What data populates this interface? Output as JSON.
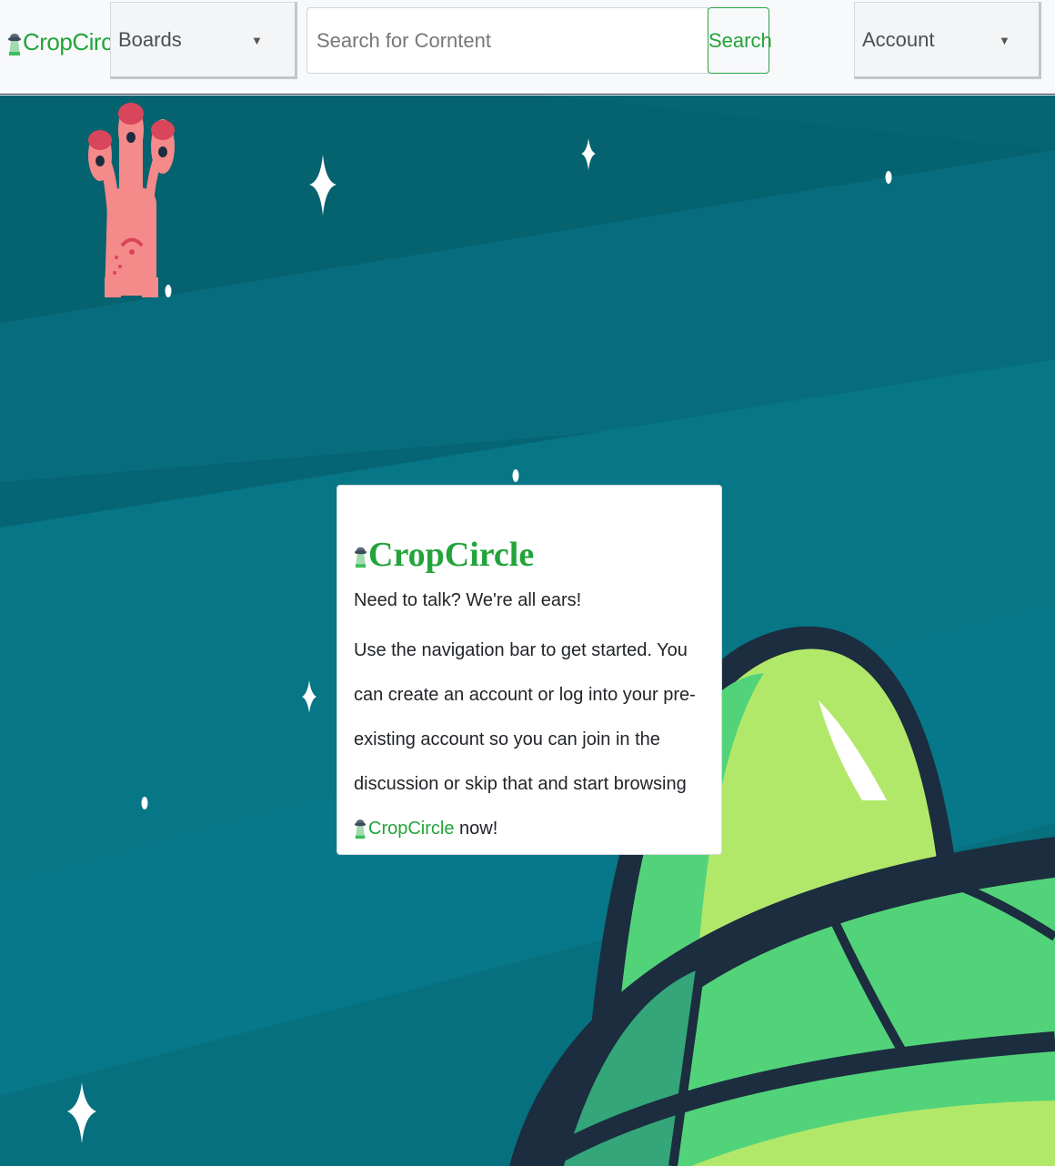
{
  "navbar": {
    "brand": "CropCircle",
    "boards_label": "Boards",
    "search_placeholder": "Search for Corntent",
    "search_button": "Search",
    "account_label": "Account",
    "caret": "▼"
  },
  "card": {
    "title": "CropCircle",
    "lead": "Need to talk? We're all ears!",
    "body_prefix": "Use the navigation bar to get started. You can create an account or log into your pre-existing account so you can join in the discussion or skip that and start browsing",
    "body_brand": "CropCircle",
    "body_suffix": " now!"
  },
  "colors": {
    "brand_green": "#22a43a",
    "sky": "#076d7e",
    "alien_pink": "#f58a8a",
    "ufo_dark": "#1b2d3e",
    "ufo_light_green": "#b2e86a",
    "ufo_green": "#52d37a"
  },
  "icons": {
    "brand": "ufo-icon",
    "dropdown": "caret-down-icon"
  }
}
